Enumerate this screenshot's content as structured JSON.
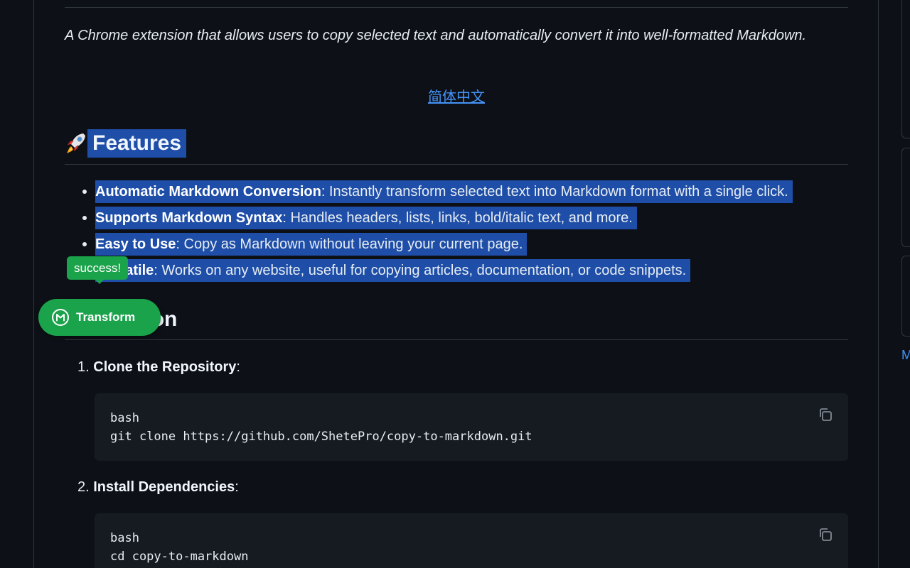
{
  "readme": {
    "tagline": "A Chrome extension that allows users to copy selected text and automatically convert it into well-formatted Markdown.",
    "lang_link": "简体中文",
    "features_heading": "Features",
    "features": [
      {
        "title": "Automatic Markdown Conversion",
        "text": ": Instantly transform selected text into Markdown format with a single click."
      },
      {
        "title": "Supports Markdown Syntax",
        "text": ": Handles headers, lists, links, bold/italic text, and more."
      },
      {
        "title": "Easy to Use",
        "text": ": Copy as Markdown without leaving your current page."
      },
      {
        "title": "Versatile",
        "text": ": Works on any website, useful for copying articles, documentation, or code snippets."
      }
    ],
    "install_heading": "Installation",
    "steps": [
      {
        "number": "1.",
        "title": "Clone the Repository",
        "suffix": ":",
        "code": [
          "bash",
          "git clone https://github.com/ShetePro/copy-to-markdown.git"
        ]
      },
      {
        "number": "2.",
        "title": "Install Dependencies",
        "suffix": ":",
        "code": [
          "bash",
          "cd copy-to-markdown"
        ]
      }
    ]
  },
  "extension": {
    "toast": "success!",
    "button_label": "Transform",
    "button_icon": "markdown-m-icon",
    "color": "#1aa34a"
  },
  "sidebar": {
    "link_fragment": "M"
  },
  "colors": {
    "background": "#0d1117",
    "selection": "#1f4ea8",
    "link": "#4493f8",
    "code_bg": "#161b22"
  }
}
